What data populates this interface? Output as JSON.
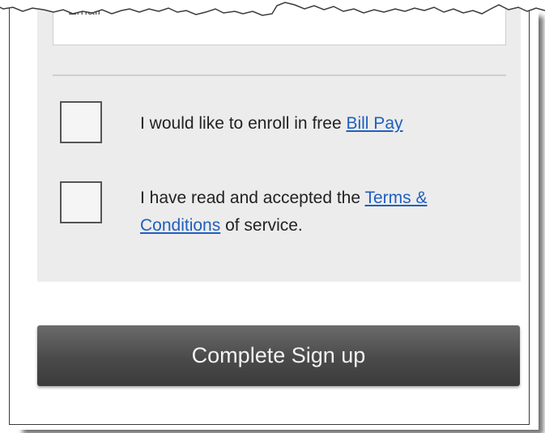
{
  "form": {
    "email_placeholder": "Email",
    "bill_pay": {
      "prefix": "I would like to enroll in free ",
      "link": "Bill Pay",
      "checked": false
    },
    "terms": {
      "prefix": "I have read and accepted the ",
      "link_part1": "Terms &",
      "link_part2": "Conditions",
      "suffix": " of service.",
      "checked": false
    },
    "submit_label": "Complete Sign up"
  }
}
